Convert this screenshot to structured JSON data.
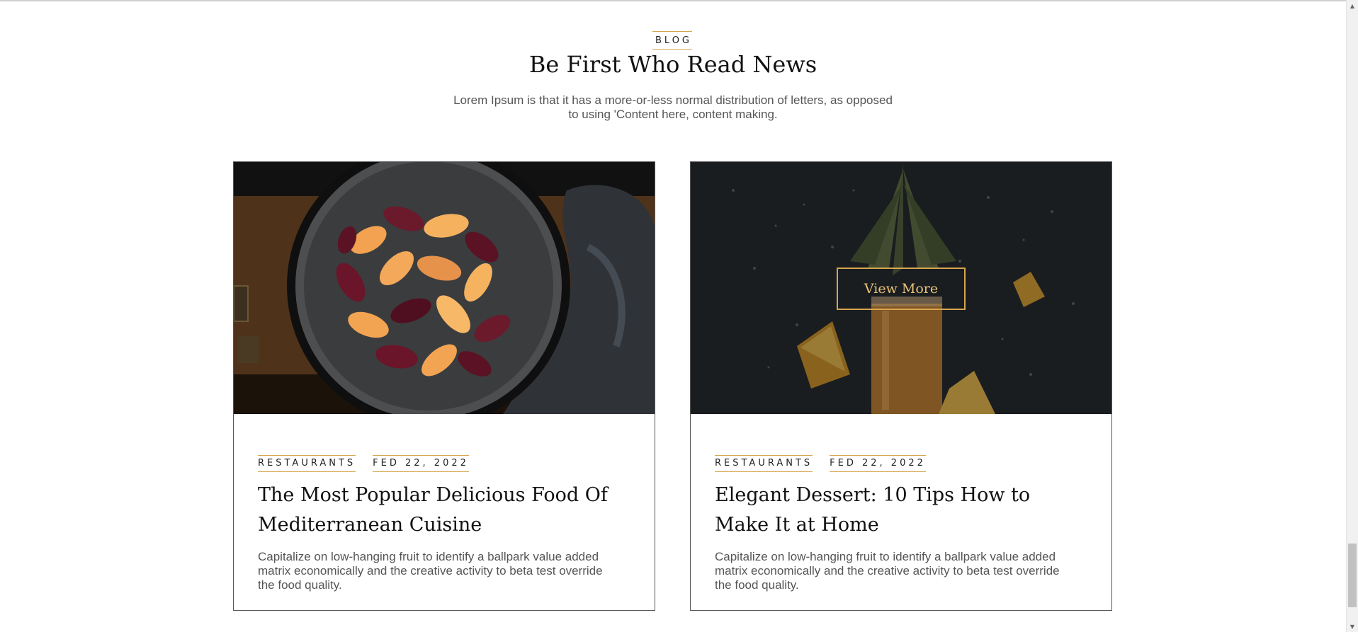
{
  "section": {
    "eyebrow": "BLOG",
    "title": "Be First Who Read News",
    "subtitle": "Lorem Ipsum is that it has a more-or-less normal distribution of letters, as opposed to using 'Content here, content making."
  },
  "posts": [
    {
      "image": "plums-in-pan-photo",
      "category": "RESTAURANTS",
      "date": "FED 22, 2022",
      "title": "The Most Popular Delicious Food Of Mediterranean Cuisine",
      "excerpt": "Capitalize on low-hanging fruit to identify a ballpark value added matrix economically and the creative activity to beta test override the food quality."
    },
    {
      "image": "pineapple-juice-photo",
      "category": "RESTAURANTS",
      "date": "FED 22, 2022",
      "title": "Elegant Dessert: 10 Tips How to Make It at Home",
      "excerpt": "Capitalize on low-hanging fruit to identify a ballpark value added matrix economically and the creative activity to beta test override the food quality.",
      "overlay_button": "View More"
    }
  ],
  "colors": {
    "accent": "#d6a64f",
    "text_dark": "#111111",
    "text_muted": "#555555",
    "card_border": "#555555"
  }
}
